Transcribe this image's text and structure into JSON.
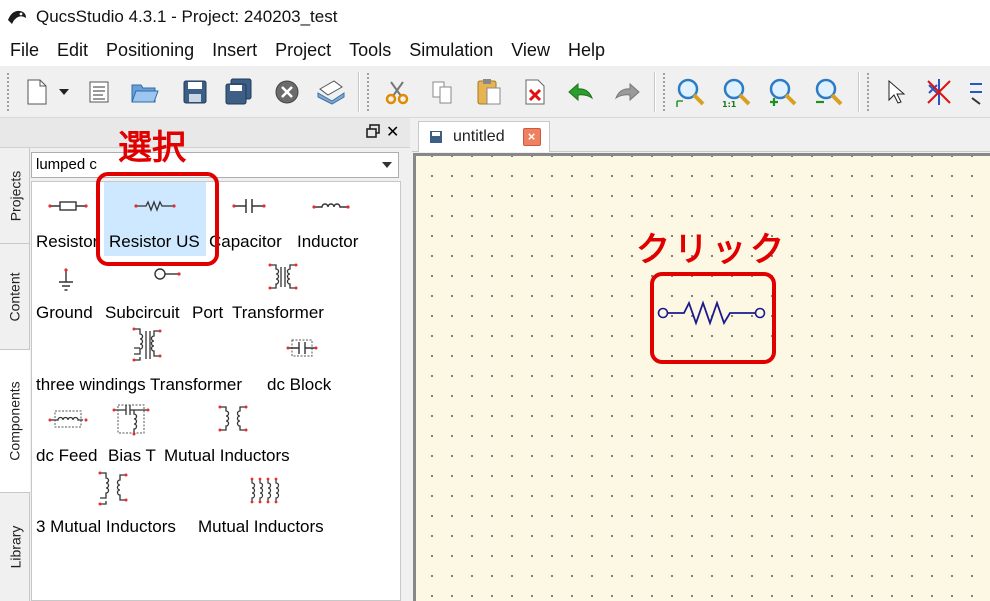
{
  "window": {
    "title": "QucsStudio 4.3.1 - Project: 240203_test"
  },
  "menu": [
    "File",
    "Edit",
    "Positioning",
    "Insert",
    "Project",
    "Tools",
    "Simulation",
    "View",
    "Help"
  ],
  "sidebar": {
    "tabs": [
      "Projects",
      "Content",
      "Components",
      "Library"
    ],
    "active_tab": "Components",
    "category": "lumped c",
    "components": [
      "Resistor",
      "Resistor US",
      "Capacitor",
      "Inductor",
      "Ground",
      "Subcircuit",
      "Port",
      "Transformer",
      "three windings Transformer",
      "dc Block",
      "dc Feed",
      "Bias T",
      "Mutual Inductors",
      "3 Mutual Inductors",
      "Mutual Inductors"
    ],
    "selected": "Resistor US"
  },
  "workspace": {
    "tab_label": "untitled"
  },
  "annotations": {
    "select": "選択",
    "click": "クリック"
  },
  "colors": {
    "annotation": "#e00000",
    "selection": "#cde8ff",
    "canvas": "#fdf8e4",
    "wire": "#1a1a8c"
  }
}
